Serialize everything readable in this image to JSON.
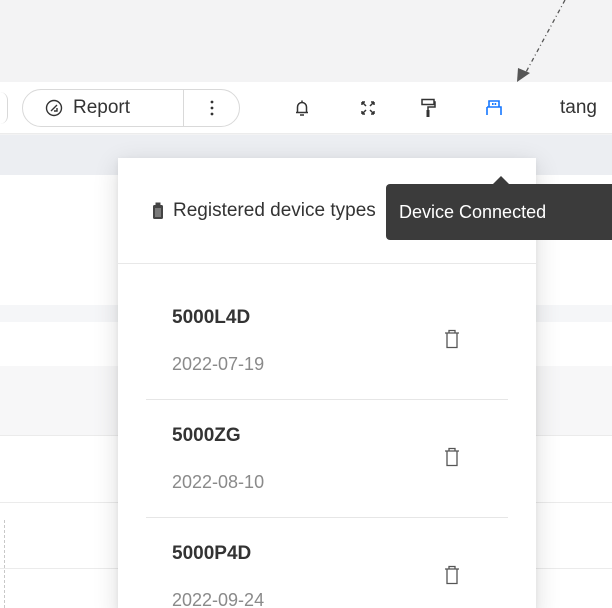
{
  "toolbar": {
    "report_label": "Report",
    "user_name": "tang",
    "device_icon_color": "#1677ff",
    "icons": [
      "report-icon",
      "more-vertical-icon",
      "bell-icon",
      "fullscreen-icon",
      "paint-roller-icon",
      "usb-device-icon"
    ]
  },
  "tooltip": {
    "text": "Device Connected"
  },
  "dropdown": {
    "title": "Registered device types",
    "items": [
      {
        "name": "5000L4D",
        "date": "2022-07-19"
      },
      {
        "name": "5000ZG",
        "date": "2022-08-10"
      },
      {
        "name": "5000P4D",
        "date": "2022-09-24"
      }
    ]
  }
}
